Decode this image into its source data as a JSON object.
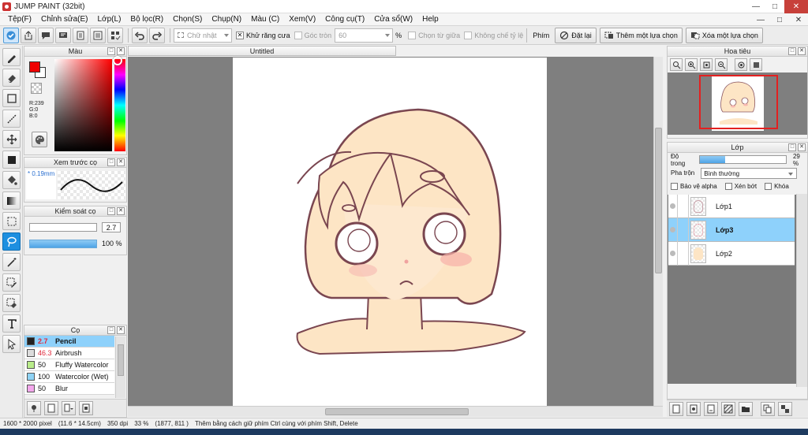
{
  "window": {
    "title": "JUMP PAINT (32bit)",
    "min_glyph": "—",
    "max_glyph": "□",
    "close_glyph": "✕"
  },
  "menu": [
    "Tệp(F)",
    "Chỉnh sửa(E)",
    "Lớp(L)",
    "Bộ lọc(R)",
    "Chọn(S)",
    "Chụp(N)",
    "Màu (C)",
    "Xem(V)",
    "Công cụ(T)",
    "Cửa sổ(W)",
    "Help"
  ],
  "toolbar": {
    "shape_select": "Chữ nhật",
    "antialias_label": "Khử răng cưa",
    "antialias_check": "✕",
    "corner_label": "Góc tròn",
    "corner_value": "60",
    "percent": "%",
    "from_center_label": "Chọn từ giữa",
    "no_ratio_label": "Không chế tỷ lệ",
    "key_label": "Phím",
    "reset_button": "Đặt lại",
    "add_selection_button": "Thêm một lựa chọn",
    "remove_selection_button": "Xóa một lựa chọn"
  },
  "color_panel": {
    "title": "Màu",
    "fg_color": "#ef0000",
    "r": "R:239",
    "g": "G:0",
    "b": "B:0"
  },
  "brush_preview": {
    "title": "Xem trước cọ",
    "size": "* 0.19mm"
  },
  "brush_control": {
    "title": "Kiểm soát cọ",
    "size_value": "2.7",
    "opacity_value": "100 %"
  },
  "brush_panel": {
    "title": "Cọ",
    "items": [
      {
        "size": "2.7",
        "name": "Pencil",
        "color": "#222222",
        "selected": true
      },
      {
        "size": "46.3",
        "name": "Airbrush",
        "color": "#dcdcdc",
        "selected": false
      },
      {
        "size": "50",
        "name": "Fluffy Watercolor",
        "color": "#b9ec8a",
        "selected": false
      },
      {
        "size": "100",
        "name": "Watercolor (Wet)",
        "color": "#8fd3f5",
        "selected": false
      },
      {
        "size": "50",
        "name": "Blur",
        "color": "#f4a7ec",
        "selected": false
      }
    ]
  },
  "document": {
    "tab_title": "Untitled"
  },
  "navigator": {
    "title": "Hoa tiêu"
  },
  "layers": {
    "title": "Lớp",
    "opacity_label": "Độ trong",
    "opacity_value": "29 %",
    "opacity_fraction": 0.29,
    "blend_label": "Pha trộn",
    "blend_value": "Bình thường",
    "protect_alpha": "Bảo vệ alpha",
    "clipping": "Xén bớt",
    "lock": "Khóa",
    "items": [
      {
        "name": "Lớp1",
        "selected": false
      },
      {
        "name": "Lớp3",
        "selected": true
      },
      {
        "name": "Lớp2",
        "selected": false
      }
    ]
  },
  "status": {
    "pixel_size": "1600 * 2000 pixel",
    "cm_size": "(11.6 * 14.5cm)",
    "dpi": "350 dpi",
    "zoom": "33 %",
    "coords": "(1877, 811 )",
    "hint": "Thêm bằng cách giữ phím Ctrl cùng với phím Shift, Delete"
  },
  "colors": {
    "accent": "#1e8fe0",
    "selection": "#8ed1fb",
    "skin": "#fde5c5",
    "line": "#7a4650"
  }
}
